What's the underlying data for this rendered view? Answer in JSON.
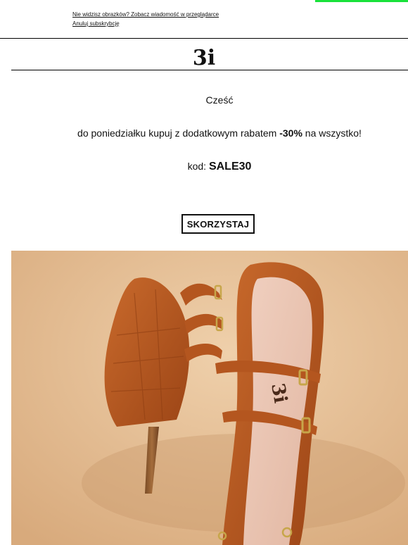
{
  "preheader": {
    "view_in_browser": "Nie widzisz obrazków? Zobacz wiadomość w przeglądarce",
    "unsubscribe": "Anuluj subskrybcję"
  },
  "header": {
    "logo_text": "3i"
  },
  "content": {
    "greeting": "Cześć",
    "promo_before": "do poniedziałku kupuj z dodatkowym rabatem",
    "promo_discount": "-30%",
    "promo_after": "na wszystko!",
    "code_label": "kod:",
    "code_value": "SALE30"
  },
  "cta": {
    "label": "SKORZYSTAJ"
  },
  "hero": {
    "insole_brand": "3i"
  },
  "colors": {
    "accent_bar": "#19e23a",
    "text": "#111111",
    "hero_background": "#e1b88e",
    "shoe_leather": "#b4561f"
  }
}
